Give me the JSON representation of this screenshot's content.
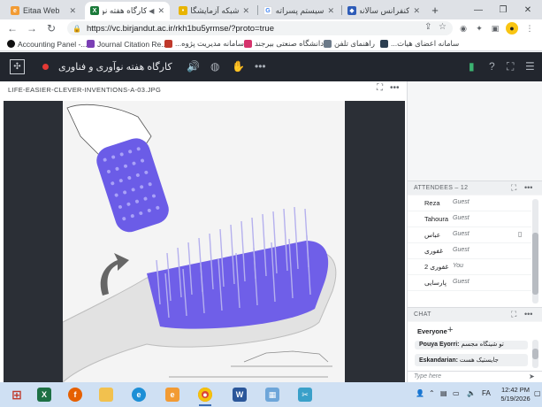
{
  "browser": {
    "tabs": [
      {
        "title": "Eitaa Web",
        "favicon": "eitaa-favicon",
        "color": "#f29b34"
      },
      {
        "title": "کارگاه هفته نو",
        "favicon": "meeting-favicon",
        "color": "#1b7a3a",
        "active": true
      },
      {
        "title": "شبکه آزمایشگاه ها",
        "favicon": "lab-favicon",
        "color": "#e8b400"
      },
      {
        "title": "سیستم پسراته",
        "favicon": "google-favicon",
        "color": "#4285f4"
      },
      {
        "title": "کنفرانس سالانه ما",
        "favicon": "conference-favicon",
        "color": "#2e5cb8"
      }
    ],
    "url": "https://vc.birjandut.ac.ir/rkh1bu5yrmse/?proto=true",
    "bookmarks": [
      {
        "label": "Accounting Panel -...",
        "color": "#111111"
      },
      {
        "label": "Journal Citation Re...",
        "color": "#7b3fb5"
      },
      {
        "label": "سامانه مدیریت پژوه...",
        "color": "#c0392b"
      },
      {
        "label": "دانشگاه صنعتی بیرجند",
        "color": "#d6336c"
      },
      {
        "label": "راهنمای تلفن",
        "color": "#6c7a89"
      },
      {
        "label": "سامانه اعضای هیات...",
        "color": "#2c3e50"
      }
    ]
  },
  "meeting": {
    "title": "کارگاه هفته نوآوری و فناوری",
    "presentation": {
      "filename": "LIFE-EASIER-CLEVER-INVENTIONS-A-03.JPG"
    },
    "attendees": {
      "header": "ATTENDEES",
      "count": "12",
      "list": [
        {
          "name": "Reza",
          "role": "Guest"
        },
        {
          "name": "Tahoura",
          "role": "Guest"
        },
        {
          "name": "عباس",
          "role": "Guest",
          "device": true
        },
        {
          "name": "غفوری",
          "role": "Guest"
        },
        {
          "name": "غفوری 2",
          "role": "You"
        },
        {
          "name": "پارسایی",
          "role": "Guest"
        }
      ]
    },
    "chat": {
      "header": "CHAT",
      "channel": "Everyone",
      "messages": [
        {
          "sender": "Pouya Eyorri:",
          "text": "تو شینگاه مجسم"
        },
        {
          "sender": "Eskandarian:",
          "text": "جایستیک هست"
        }
      ],
      "input_placeholder": "Type here"
    }
  },
  "taskbar": {
    "time": "12:42 PM",
    "date": "5/19/2026",
    "language": "FA"
  }
}
